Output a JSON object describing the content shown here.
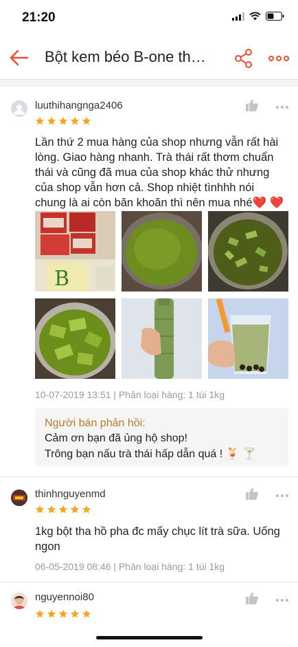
{
  "status": {
    "time": "21:20",
    "signal_icon": "signal-bars-icon",
    "wifi_icon": "wifi-icon",
    "battery_icon": "battery-icon"
  },
  "header": {
    "title": "Bột kem béo B-one th…",
    "back_icon": "back-arrow-icon",
    "share_icon": "share-icon",
    "more_icon": "more-horizontal-icon"
  },
  "colors": {
    "accent": "#ee4d2d",
    "star": "#f5a623",
    "seller_title": "#b87a2f",
    "meta": "#9b9b9b"
  },
  "reviews": [
    {
      "username": "luuthihangnga2406",
      "rating": 5,
      "text": "Lần thứ 2 mua hàng của shop nhưng vẫn rất hài lòng. Giao hàng nhanh. Trà thái rất thơm chuẩn thái và cũng đã mua của shop khác thử nhưng của shop vẫn hơn cả. Shop nhiệt tìnhhh nói chung là ai còn băn khoăn thì nên mua nhé❤️ ❤️",
      "photos": [
        "tea-packages-photo",
        "green-tea-pot-photo",
        "jelly-in-pot-photo",
        "green-jelly-bowl-photo",
        "tea-bottle-photo",
        "bubble-tea-cup-photo"
      ],
      "meta": "10-07-2019 13:51 | Phân loại hàng: 1 túi 1kg",
      "seller_reply": {
        "title": "Người bán phản hồi:",
        "line1": "Cảm ơn bạn đã ủng hộ shop!",
        "line2": "Trông bạn nấu trà thái hấp dẫn quá ! 🍹 🍸"
      }
    },
    {
      "username": "thinhnguyenmd",
      "rating": 5,
      "text": "1kg bột tha hồ pha đc mấy chục lít trà sữa. Uống ngon",
      "meta": "06-05-2019 08:46 | Phân loại hàng: 1 túi 1kg"
    },
    {
      "username": "nguyennoi80",
      "rating": 5
    }
  ]
}
